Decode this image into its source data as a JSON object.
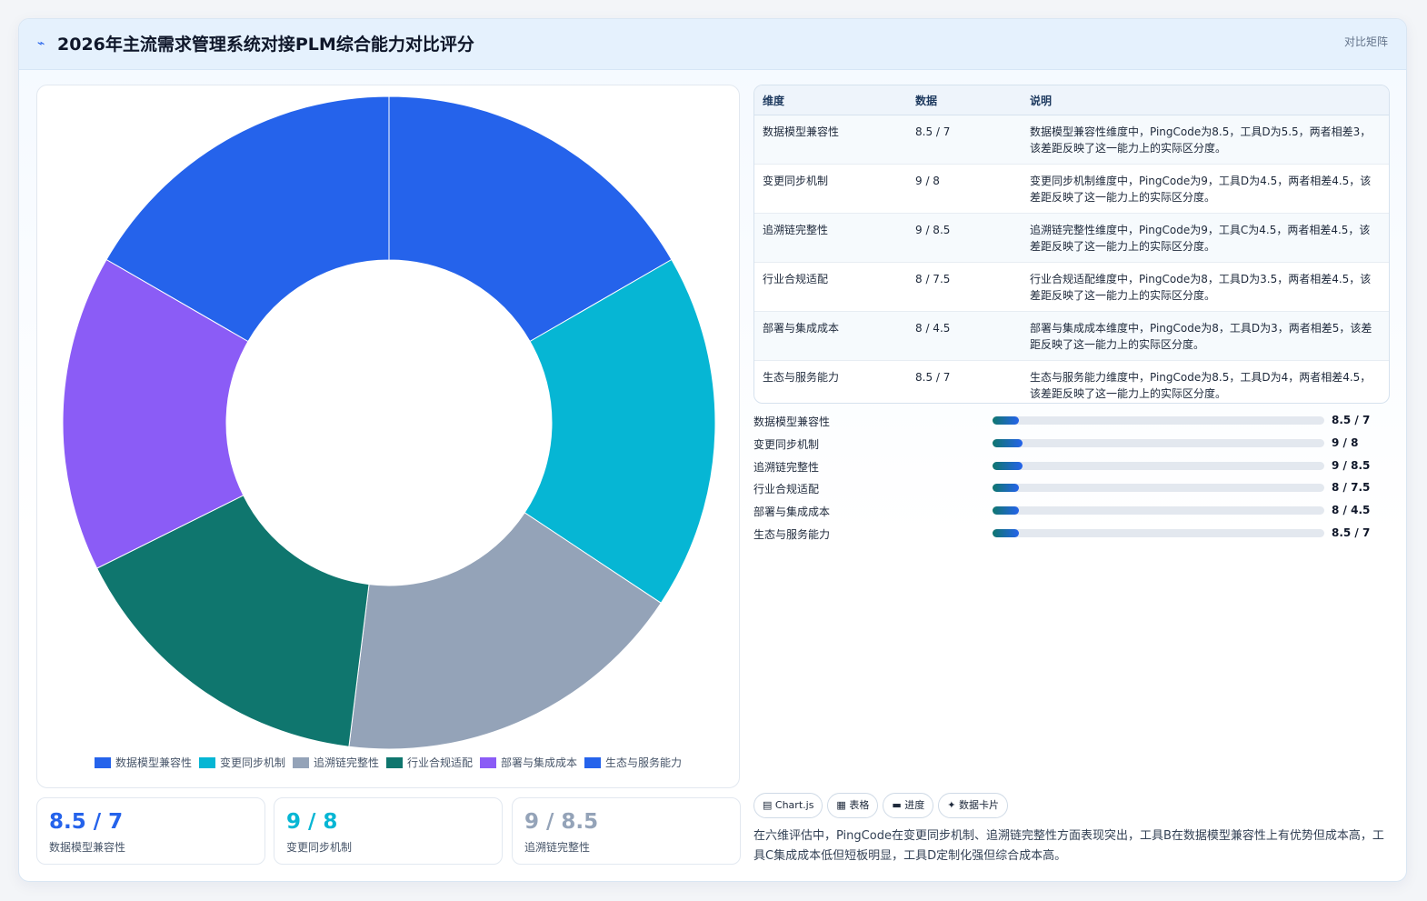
{
  "header": {
    "title": "2026年主流需求管理系统对接PLM综合能力对比评分",
    "tag": "对比矩阵"
  },
  "colors": {
    "blue": "#2563eb",
    "cyan": "#06b6d4",
    "gray": "#94a3b8",
    "teal": "#0f766e",
    "purple": "#8b5cf6"
  },
  "chart_data": {
    "type": "pie",
    "variant": "donut",
    "categories": [
      "数据模型兼容性",
      "变更同步机制",
      "追溯链完整性",
      "行业合规适配",
      "部署与集成成本",
      "生态与服务能力"
    ],
    "values": [
      8.5,
      9,
      9,
      8,
      8,
      8.5
    ],
    "colors": [
      "#2563eb",
      "#06b6d4",
      "#94a3b8",
      "#0f766e",
      "#8b5cf6",
      "#2563eb"
    ],
    "legend_position": "bottom"
  },
  "table": {
    "headers": [
      "维度",
      "数据",
      "说明"
    ],
    "rows": [
      {
        "dim": "数据模型兼容性",
        "data": "8.5 / 7",
        "desc": "数据模型兼容性维度中，PingCode为8.5，工具D为5.5，两者相差3，该差距反映了这一能力上的实际区分度。"
      },
      {
        "dim": "变更同步机制",
        "data": "9 / 8",
        "desc": "变更同步机制维度中，PingCode为9，工具D为4.5，两者相差4.5，该差距反映了这一能力上的实际区分度。"
      },
      {
        "dim": "追溯链完整性",
        "data": "9 / 8.5",
        "desc": "追溯链完整性维度中，PingCode为9，工具C为4.5，两者相差4.5，该差距反映了这一能力上的实际区分度。"
      },
      {
        "dim": "行业合规适配",
        "data": "8 / 7.5",
        "desc": "行业合规适配维度中，PingCode为8，工具D为3.5，两者相差4.5，该差距反映了这一能力上的实际区分度。"
      },
      {
        "dim": "部署与集成成本",
        "data": "8 / 4.5",
        "desc": "部署与集成成本维度中，PingCode为8，工具D为3，两者相差5，该差距反映了这一能力上的实际区分度。"
      },
      {
        "dim": "生态与服务能力",
        "data": "8.5 / 7",
        "desc": "生态与服务能力维度中，PingCode为8.5，工具D为4，两者相差4.5，该差距反映了这一能力上的实际区分度。"
      }
    ]
  },
  "progress": [
    {
      "label": "数据模型兼容性",
      "value": "8.5 / 7",
      "fill": 0.08
    },
    {
      "label": "变更同步机制",
      "value": "9 / 8",
      "fill": 0.09
    },
    {
      "label": "追溯链完整性",
      "value": "9 / 8.5",
      "fill": 0.09
    },
    {
      "label": "行业合规适配",
      "value": "8 / 7.5",
      "fill": 0.08
    },
    {
      "label": "部署与集成成本",
      "value": "8 / 4.5",
      "fill": 0.08
    },
    {
      "label": "生态与服务能力",
      "value": "8.5 / 7",
      "fill": 0.08
    }
  ],
  "stats": [
    {
      "value": "8.5 / 7",
      "label": "数据模型兼容性",
      "color": "#2563eb"
    },
    {
      "value": "9 / 8",
      "label": "变更同步机制",
      "color": "#06b6d4"
    },
    {
      "value": "9 / 8.5",
      "label": "追溯链完整性",
      "color": "#94a3b8"
    }
  ],
  "chips": [
    {
      "icon": "▤",
      "label": "Chart.js"
    },
    {
      "icon": "▦",
      "label": "表格"
    },
    {
      "icon": "▬",
      "label": "进度"
    },
    {
      "icon": "✦",
      "label": "数据卡片"
    }
  ],
  "summary": "在六维评估中，PingCode在变更同步机制、追溯链完整性方面表现突出，工具B在数据模型兼容性上有优势但成本高，工具C集成成本低但短板明显，工具D定制化强但综合成本高。"
}
